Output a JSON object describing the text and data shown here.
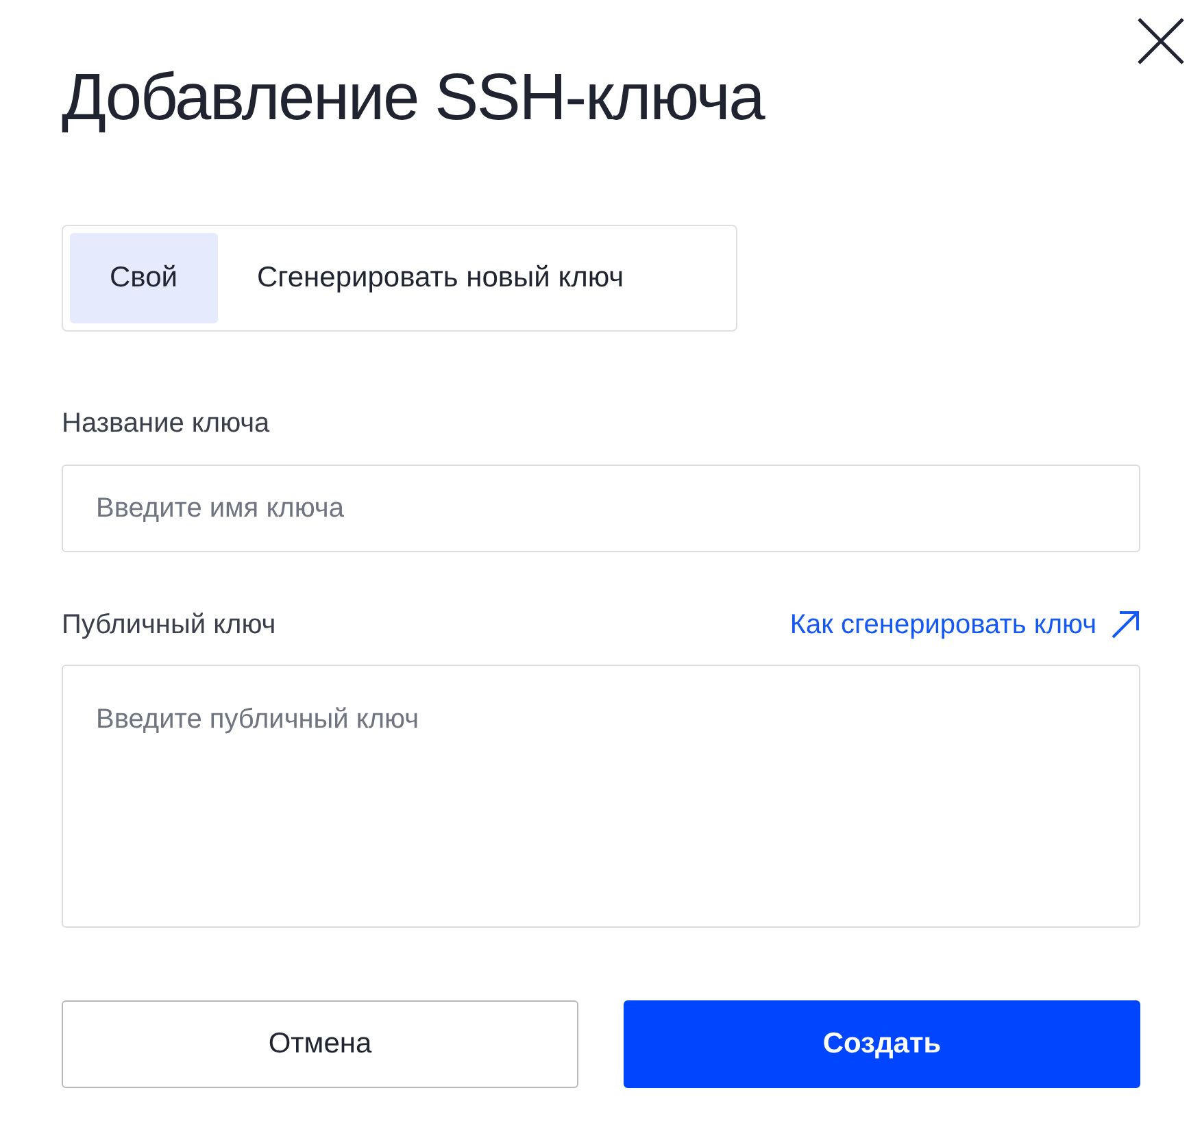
{
  "dialog": {
    "title": "Добавление SSH-ключа"
  },
  "tabs": [
    {
      "label": "Свой",
      "selected": true
    },
    {
      "label": "Сгенерировать новый ключ",
      "selected": false
    }
  ],
  "name_field": {
    "label": "Название ключа",
    "placeholder": "Введите имя ключа"
  },
  "key_field": {
    "label": "Публичный ключ",
    "placeholder": "Введите публичный ключ"
  },
  "help_link": {
    "label": "Как сгенерировать ключ"
  },
  "buttons": [
    {
      "label": "Отмена",
      "kind": "secondary"
    },
    {
      "label": "Создать",
      "kind": "primary"
    }
  ]
}
